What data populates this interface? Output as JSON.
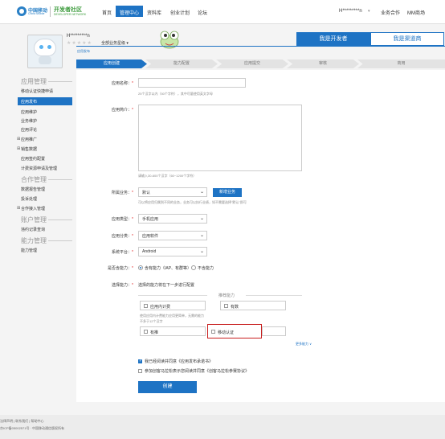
{
  "header": {
    "logo_cn": "中国移动",
    "logo_en": "China Mobile",
    "portal_cn": "开发者社区",
    "portal_en": "DEVELOPER NETWORK",
    "nav": [
      "首页",
      "管理中心",
      "资料库",
      "创业计划",
      "论坛"
    ],
    "user": "H*********n",
    "user_caret": "▾",
    "business": "业务合作",
    "mm": "MM商场"
  },
  "profile": {
    "name": "H*********n",
    "stars": "★★★★★",
    "level": "全部业务星级 ▾",
    "tab_developer": "我是开发者",
    "tab_channel": "我是渠道商"
  },
  "breadcrumb": "应用发布",
  "steps": [
    "应用创建",
    "能力配置",
    "应用提交",
    "审核",
    "商用"
  ],
  "sidebar": {
    "sections": [
      {
        "title": "应用管理",
        "items": [
          "移动认证快捷申请",
          "应用发布",
          "应用维护",
          "业务维护",
          "应用评论",
          "应用推广",
          "销售数据",
          "应用签约配置",
          "计费资源申请及管理"
        ]
      },
      {
        "title": "合作管理",
        "items": [
          "数据报告管理",
          "投诉处理",
          "合作接入管理"
        ]
      },
      {
        "title": "账户管理",
        "items": [
          "违约记录查询"
        ]
      },
      {
        "title": "能力管理",
        "items": [
          "能力管理"
        ]
      }
    ],
    "active": "应用发布"
  },
  "form": {
    "req_mark": "*",
    "app_name_label": "应用名称：",
    "app_name_value": "",
    "app_name_hint": "25个汉字以内（50个字符），其中尽量使用英文字母",
    "intro_label": "应用简介：",
    "intro_value": "",
    "intro_hint": "请输入30-600个汉字（60~1200个字符）",
    "business_label": "所属业务：",
    "business_value": "默认",
    "new_business_button": "新增业务",
    "business_hint": "可以将应用归属到不同的业务，业务可以执行业绩，如不需要选择\"默认\"即可",
    "type_label": "应用类型：",
    "type_value": "手机应用",
    "category_label": "应用分类：",
    "category_value": "应用软件",
    "platform_label": "系统平台：",
    "platform_value": "Android",
    "contains_label": "是否含能力：",
    "contains_yes": "含有能力（IAP、有群等）",
    "contains_no": "不含能力",
    "choose_label": "选择能力：",
    "choose_hint": "选择的能力将在下一步进行配置",
    "recommend_title": "推荐能力",
    "abilities_row1": [
      "应用内计费",
      "有数"
    ],
    "abilities_note": "使用应用内计费能力应用更简单，无需的能力",
    "abilities_note2": "不多于12个汉字",
    "abilities_row2": [
      "有推",
      "移动认证"
    ],
    "more_abilities": "更多能力 ∨",
    "agree_1": "我已经阅读并同意《应用发布承诺书》",
    "agree_2": "参加创客马拉松表示您阅读并同意《创客马拉松参赛协议》",
    "submit": "创建"
  },
  "footer": {
    "links": "法律声明 | 联系我们 | 帮助中心",
    "icp": "京ICP备05002571号 · 中国移动通信版权所有"
  }
}
